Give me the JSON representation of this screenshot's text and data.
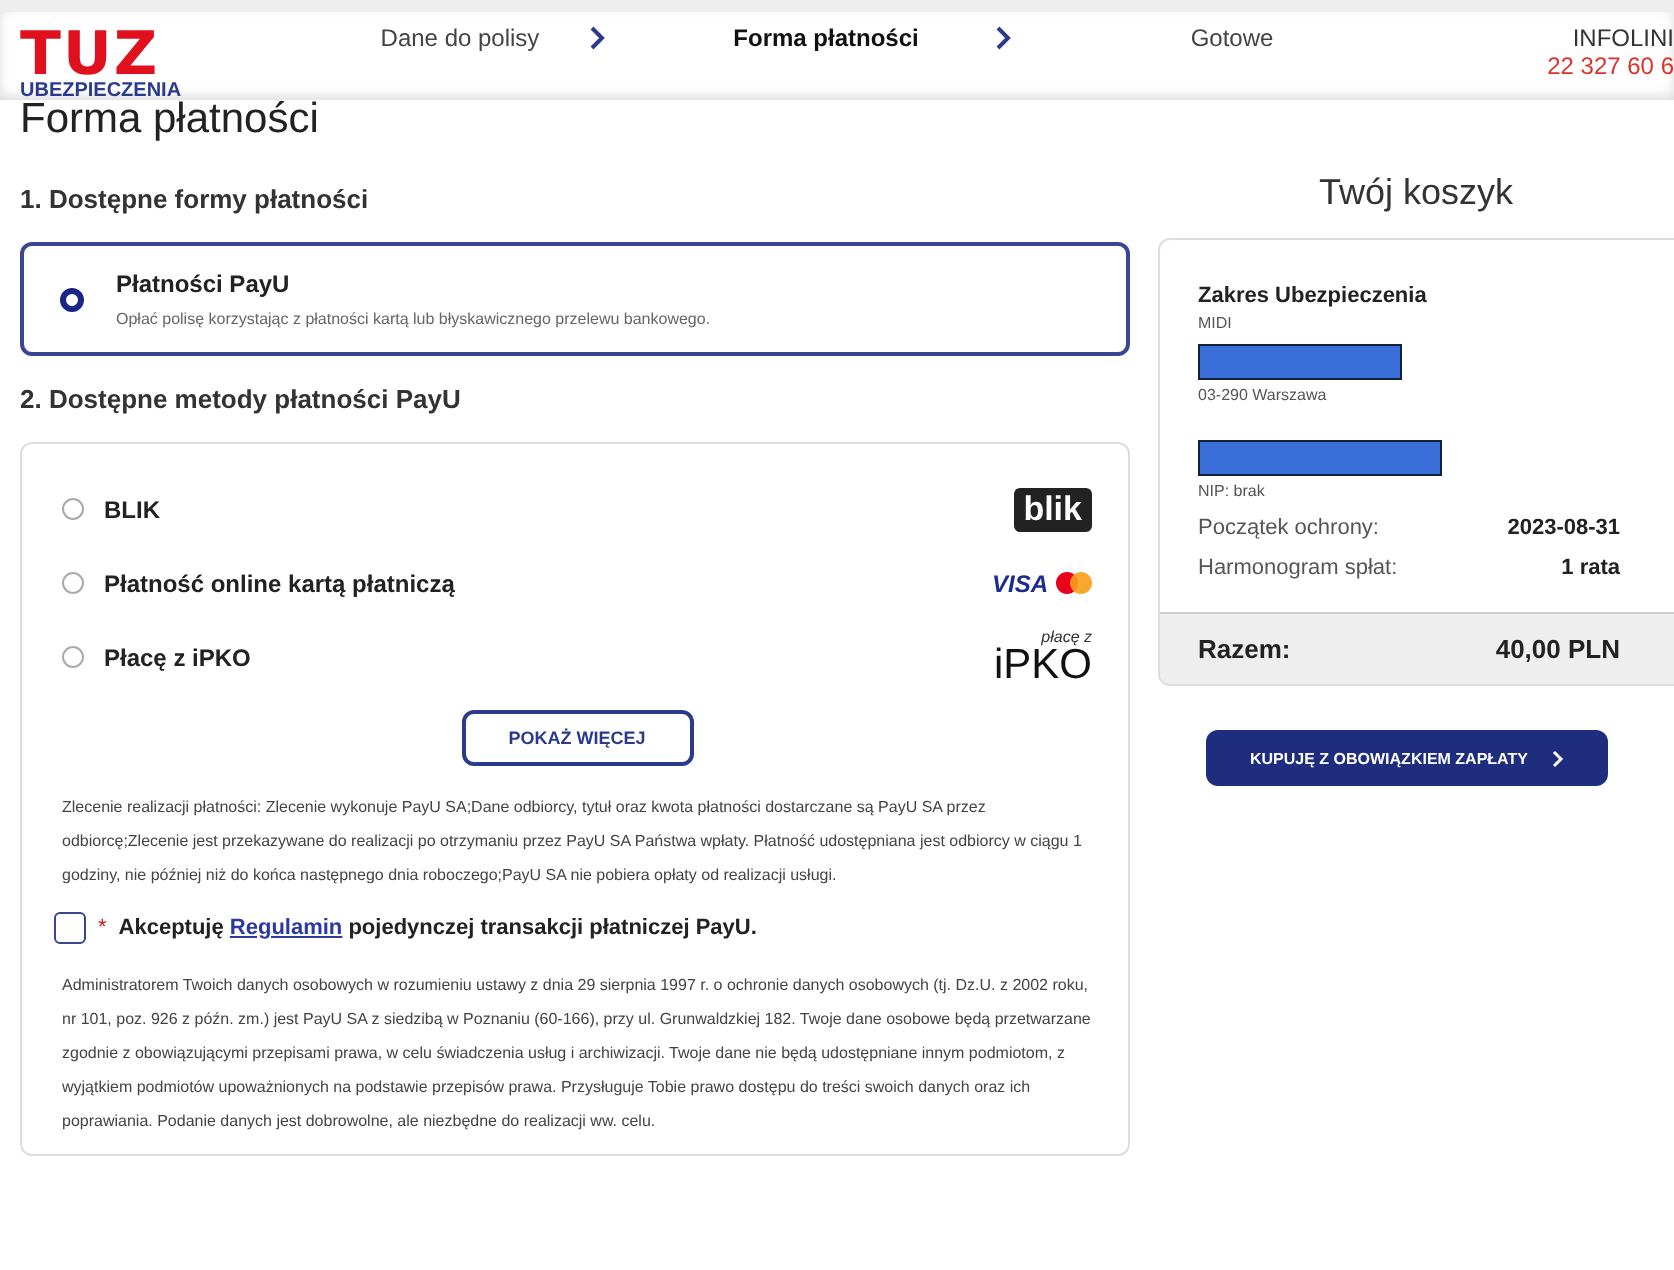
{
  "logo": {
    "name": "TUZ",
    "sub": "UBEZPIECZENIA"
  },
  "steps": [
    {
      "label": "Dane do polisy",
      "selected": false
    },
    {
      "label": "Forma płatności",
      "selected": true
    },
    {
      "label": "Gotowe",
      "selected": false
    }
  ],
  "hotline": {
    "label": "INFOLINI",
    "phone": "22 327 60 6"
  },
  "page_title": "Forma płatności",
  "section1": {
    "title": "1. Dostępne formy płatności",
    "options": [
      {
        "name": "Płatności PayU",
        "description": "Opłać polisę korzystając z płatności kartą lub błyskawicznego przelewu bankowego.",
        "selected": true
      }
    ]
  },
  "section2": {
    "title": "2. Dostępne metody płatności PayU",
    "methods": [
      {
        "label": "BLIK",
        "selected": false,
        "kind": "blik",
        "logo_text": [
          "blik"
        ]
      },
      {
        "label": "Płatność online kartą płatniczą",
        "selected": false,
        "kind": "card",
        "logo_text": [
          "VISA"
        ]
      },
      {
        "label": "Płacę z iPKO",
        "selected": false,
        "kind": "ipko",
        "logo_text": [
          "płacę z",
          "iPKO"
        ]
      }
    ],
    "more_button": "POKAŻ WIĘCEJ",
    "info": "Zlecenie realizacji płatności: Zlecenie wykonuje PayU SA;Dane odbiorcy, tytuł oraz kwota płatności dostarczane są PayU SA przez odbiorcę;Zlecenie jest przekazywane do realizacji po otrzymaniu przez PayU SA Państwa wpłaty. Płatność udostępniana jest odbiorcy w ciągu 1 godziny, nie później niż do końca następnego dnia roboczego;PayU SA nie pobiera opłaty od realizacji usługi.",
    "consent": {
      "checked": false,
      "required_mark": "*",
      "before": "Akceptuję",
      "link": "Regulamin",
      "after": "pojedynczej transakcji płatniczej PayU."
    },
    "privacy": "Administratorem Twoich danych osobowych w rozumieniu ustawy z dnia 29 sierpnia 1997 r. o ochronie danych osobowych (tj. Dz.U. z 2002 roku, nr 101, poz. 926 z późn. zm.) jest PayU SA z siedzibą w Poznaniu (60-166), przy ul. Grunwaldzkiej 182. Twoje dane osobowe będą przetwarzane zgodnie z obowiązującymi przepisami prawa, w celu świadczenia usług i archiwizacji. Twoje dane nie będą udostępniane innym podmiotom, z wyjątkiem podmiotów upoważnionych na podstawie przepisów prawa. Przysługuje Tobie prawo dostępu do treści swoich danych oraz ich poprawiania. Podanie danych jest dobrowolne, ale niezbędne do realizacji ww. celu."
  },
  "cart": {
    "title": "Twój koszyk",
    "scope_label": "Zakres Ubezpieczenia",
    "scope_value": "MIDI",
    "address": "03-290 Warszawa",
    "nip": "NIP: brak",
    "rows": [
      {
        "label": "Początek ochrony:",
        "value": "2023-08-31"
      },
      {
        "label": "Harmonogram spłat:",
        "value": "1 rata"
      }
    ],
    "total_label": "Razem:",
    "total_value": "40,00 PLN",
    "buy_button": "KUPUJĘ Z OBOWIĄZKIEM ZAPŁATY"
  }
}
